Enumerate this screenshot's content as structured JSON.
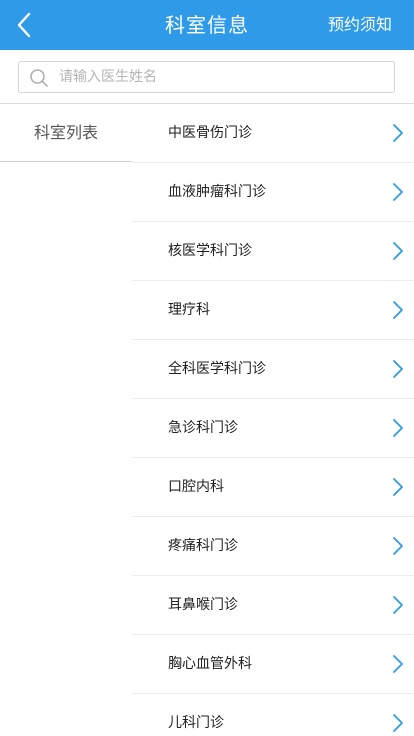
{
  "header": {
    "title": "科室信息",
    "right_label": "预约须知",
    "back_icon": "back-arrow-icon"
  },
  "search": {
    "placeholder": "请输入医生姓名",
    "value": "",
    "icon": "search-icon"
  },
  "sidebar": {
    "items": [
      {
        "label": "科室列表",
        "selected": true
      }
    ]
  },
  "departments": [
    {
      "name": "中医骨伤门诊"
    },
    {
      "name": "血液肿瘤科门诊"
    },
    {
      "name": "核医学科门诊"
    },
    {
      "name": "理疗科"
    },
    {
      "name": "全科医学科门诊"
    },
    {
      "name": "急诊科门诊"
    },
    {
      "name": "口腔内科"
    },
    {
      "name": "疼痛科门诊"
    },
    {
      "name": "耳鼻喉门诊"
    },
    {
      "name": "胸心血管外科"
    },
    {
      "name": "儿科门诊"
    }
  ],
  "colors": {
    "header_bg": "#2f9be8",
    "chevron": "#2f9be8",
    "text": "#222222",
    "muted": "#555555"
  }
}
